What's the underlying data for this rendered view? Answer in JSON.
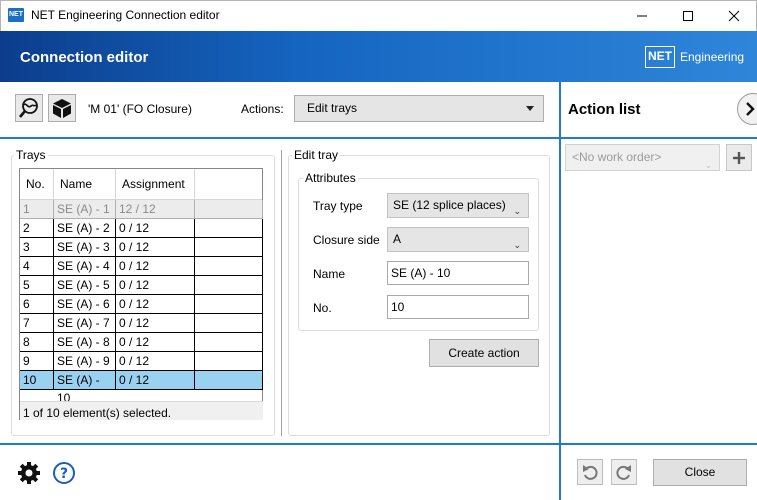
{
  "window": {
    "title": "NET Engineering Connection editor",
    "app_icon_text": "NET",
    "minimize_icon": "minimize-icon",
    "maximize_icon": "maximize-icon",
    "close_icon": "close-icon"
  },
  "header": {
    "title": "Connection editor",
    "brand_badge": "NET",
    "brand_name": "Engineering",
    "gradient_colors": [
      "#0c3d8c",
      "#2f86d9"
    ]
  },
  "toolbar": {
    "object_label": "'M 01' (FO Closure)",
    "actions_label": "Actions:",
    "actions_value": "Edit trays"
  },
  "trays": {
    "group_label": "Trays",
    "columns": [
      "No.",
      "Name",
      "Assignment"
    ],
    "rows": [
      {
        "no": "1",
        "name": "SE (A) - 1",
        "assignment": "12 / 12",
        "state": "disabled"
      },
      {
        "no": "2",
        "name": "SE (A) - 2",
        "assignment": "0 / 12",
        "state": "normal"
      },
      {
        "no": "3",
        "name": "SE (A) - 3",
        "assignment": "0 / 12",
        "state": "normal"
      },
      {
        "no": "4",
        "name": "SE (A) - 4",
        "assignment": "0 / 12",
        "state": "normal"
      },
      {
        "no": "5",
        "name": "SE (A) - 5",
        "assignment": "0 / 12",
        "state": "normal"
      },
      {
        "no": "6",
        "name": "SE (A) - 6",
        "assignment": "0 / 12",
        "state": "normal"
      },
      {
        "no": "7",
        "name": "SE (A) - 7",
        "assignment": "0 / 12",
        "state": "normal"
      },
      {
        "no": "8",
        "name": "SE (A) - 8",
        "assignment": "0 / 12",
        "state": "normal"
      },
      {
        "no": "9",
        "name": "SE (A) - 9",
        "assignment": "0 / 12",
        "state": "normal"
      },
      {
        "no": "10",
        "name": "SE (A) - 10",
        "assignment": "0 / 12",
        "state": "selected"
      }
    ],
    "status": "1 of 10 element(s) selected.",
    "selected_color": "#99d1f0"
  },
  "edit_tray": {
    "group_label": "Edit tray",
    "attributes_label": "Attributes",
    "tray_type_label": "Tray type",
    "tray_type_value": "SE (12 splice places)",
    "closure_side_label": "Closure side",
    "closure_side_value": "A",
    "name_label": "Name",
    "name_value": "SE (A) - 10",
    "no_label": "No.",
    "no_value": "10",
    "create_action": "Create action"
  },
  "action_list": {
    "title": "Action list",
    "work_order_placeholder": "<No work order>"
  },
  "footer": {
    "close_label": "Close"
  },
  "accent_color": "#1e7bd1"
}
